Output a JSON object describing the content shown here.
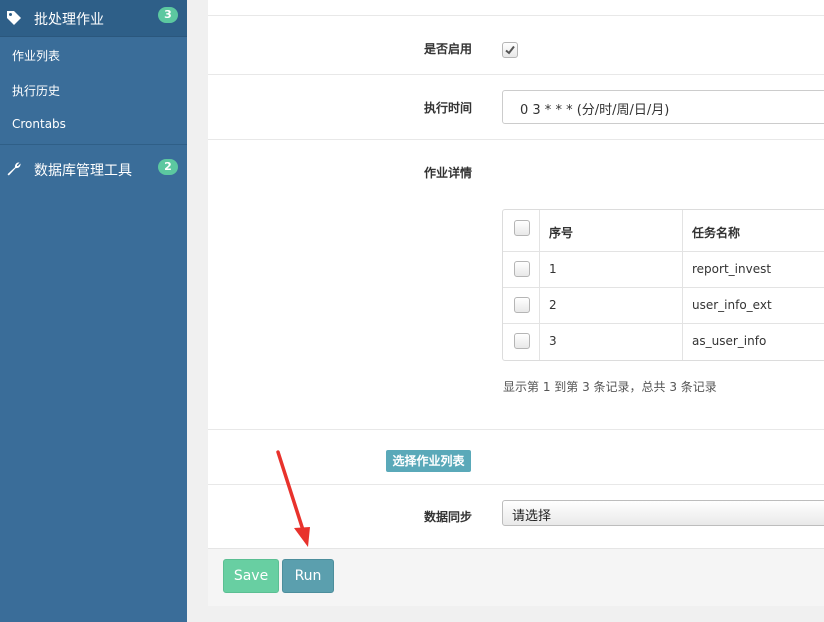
{
  "sidebar": {
    "group1": {
      "label": "批处理作业",
      "badge": "3",
      "icon": "tag-icon"
    },
    "items": [
      {
        "label": "作业列表"
      },
      {
        "label": "执行历史"
      },
      {
        "label": "Crontabs"
      }
    ],
    "group2": {
      "label": "数据库管理工具",
      "badge": "2",
      "icon": "wrench-icon"
    }
  },
  "form": {
    "enabled_label": "是否启用",
    "enabled_checked": true,
    "time_label": "执行时间",
    "time_value": "0 3 * * * (分/时/周/日/月)",
    "details_label": "作业详情",
    "table": {
      "headers": [
        "序号",
        "任务名称"
      ],
      "rows": [
        {
          "no": "1",
          "name": "report_invest"
        },
        {
          "no": "2",
          "name": "user_info_ext"
        },
        {
          "no": "3",
          "name": "as_user_info"
        }
      ],
      "summary": "显示第 1 到第 3 条记录，总共 3 条记录"
    },
    "select_jobs_button": "选择作业列表",
    "sync_label": "数据同步",
    "sync_value": "请选择"
  },
  "actions": {
    "save": "Save",
    "run": "Run"
  },
  "colors": {
    "sidebar": "#3a6d99",
    "badge": "#5cc8a0",
    "save": "#68cfa2",
    "run": "#5b9fae",
    "annotation_arrow": "#e8322c"
  }
}
